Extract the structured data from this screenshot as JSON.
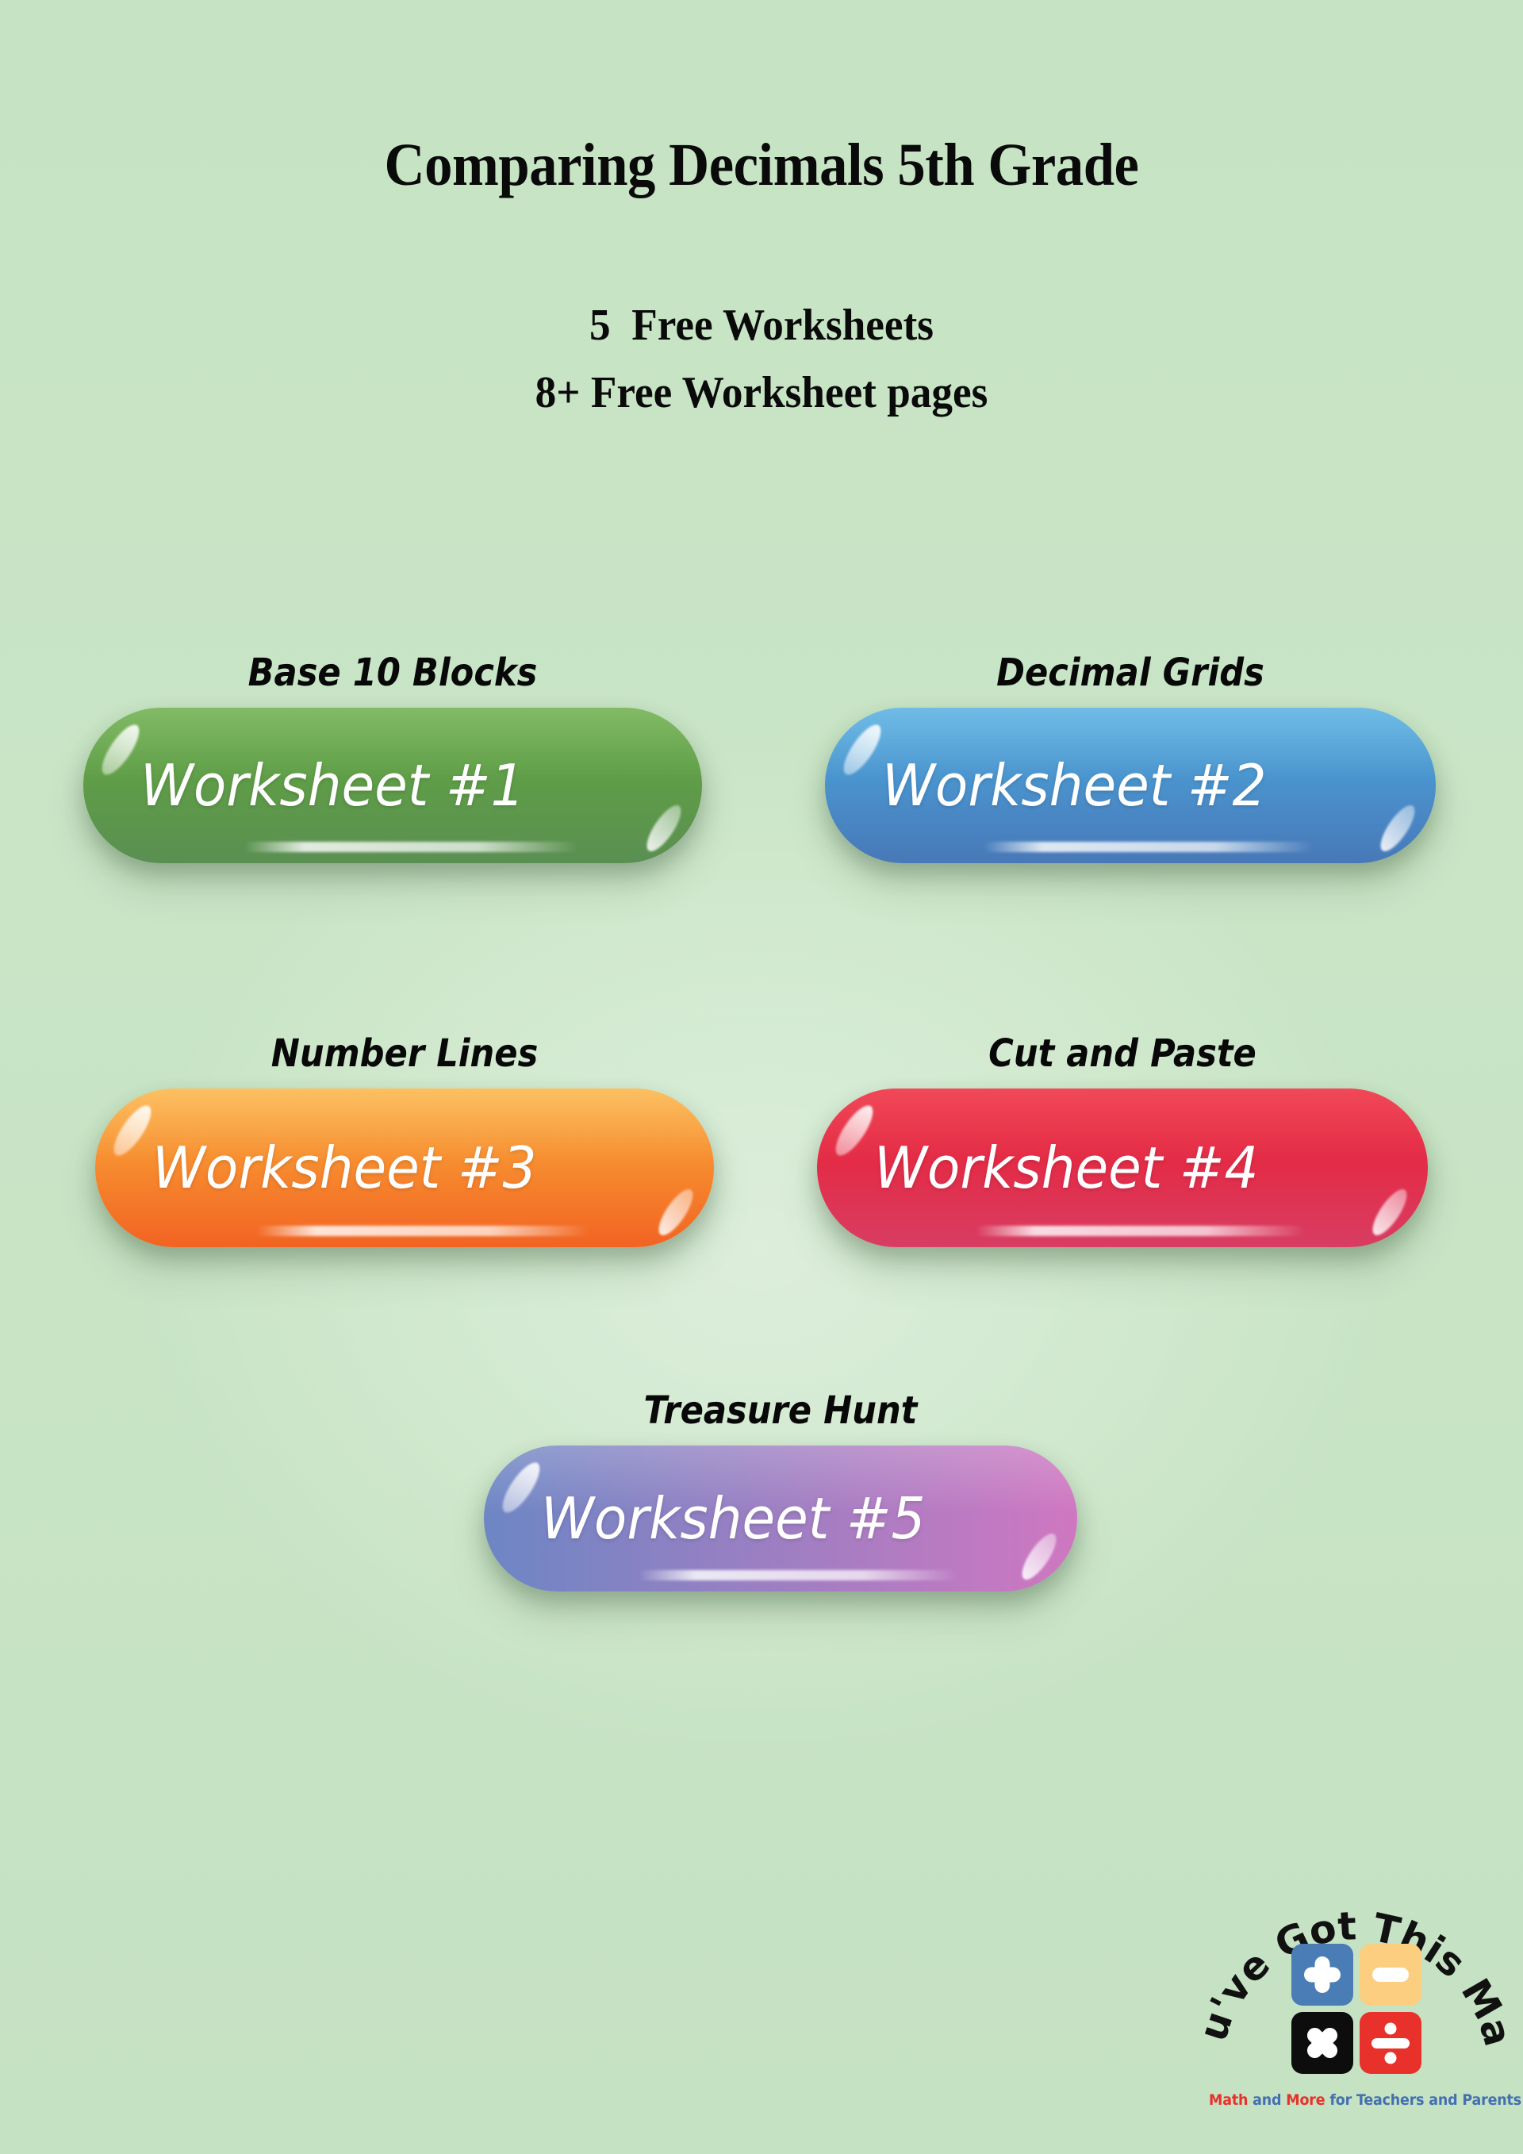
{
  "page": {
    "background_color": "#c6e3c4",
    "title": "Comparing Decimals 5th Grade",
    "subtitle_line1": "5  Free Worksheets",
    "subtitle_line2": "8+ Free Worksheet pages"
  },
  "worksheets": [
    {
      "caption": "Base 10 Blocks",
      "button_label": "Worksheet #1",
      "color_top": "#63a93f",
      "color_bottom": "#5a8f52",
      "gradient_direction": "vertical"
    },
    {
      "caption": "Decimal Grids",
      "button_label": "Worksheet #2",
      "color_top": "#4cabe0",
      "color_bottom": "#4878b8",
      "gradient_direction": "vertical"
    },
    {
      "caption": "Number Lines",
      "button_label": "Worksheet #3",
      "color_top": "#fbb03b",
      "color_bottom": "#f26322",
      "gradient_direction": "vertical"
    },
    {
      "caption": "Cut and Paste",
      "button_label": "Worksheet #4",
      "color_top": "#ed1c2e",
      "color_bottom": "#d83d63",
      "gradient_direction": "vertical"
    },
    {
      "caption": "Treasure Hunt",
      "button_label": "Worksheet #5",
      "color_top": "#6d86c4",
      "color_bottom": "#cf77c1",
      "gradient_direction": "horizontal"
    }
  ],
  "logo": {
    "arc_text": "You've Got This Math",
    "tagline_part1": "Math",
    "tagline_part2": " and ",
    "tagline_part3": "More",
    "tagline_part4": " for Teachers and Parents",
    "operators": [
      {
        "name": "plus",
        "symbol": "+",
        "bg": "#4a7cb5"
      },
      {
        "name": "minus",
        "symbol": "−",
        "bg": "#fbce80"
      },
      {
        "name": "multiply",
        "symbol": "×",
        "bg": "#0d0d0d"
      },
      {
        "name": "divide",
        "symbol": "÷",
        "bg": "#e8312b"
      }
    ],
    "tagline_red_color": "#e8312b",
    "tagline_blue_color": "#4470b0"
  }
}
